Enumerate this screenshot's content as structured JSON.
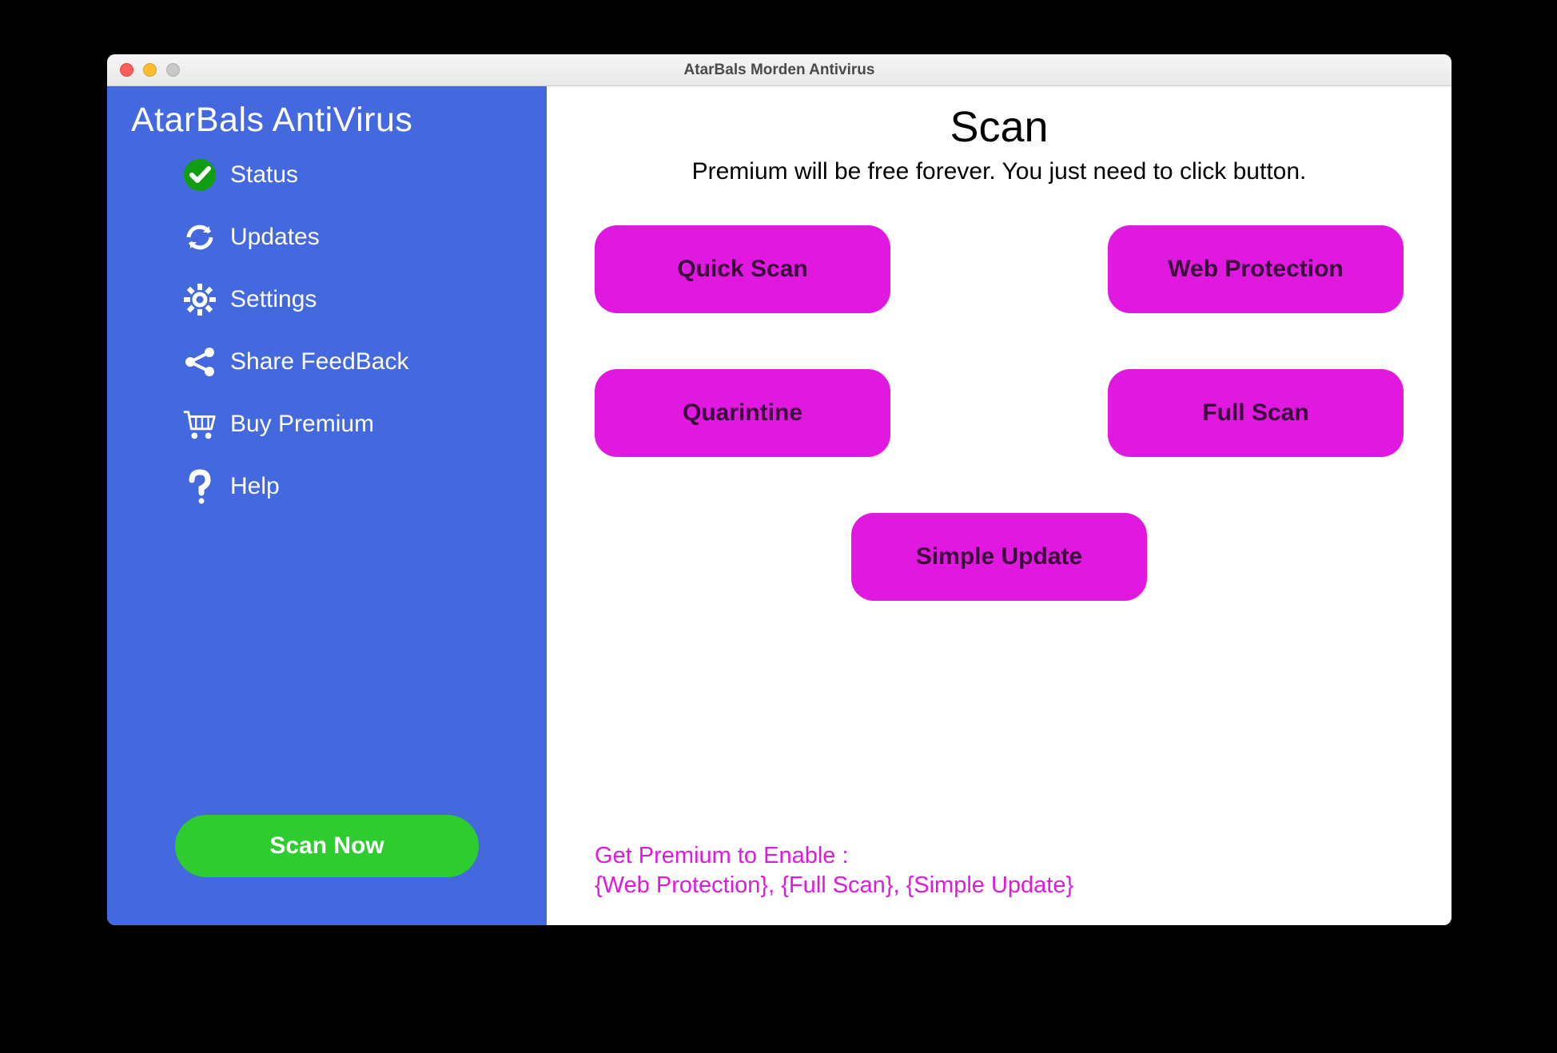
{
  "window": {
    "title": "AtarBals Morden Antivirus"
  },
  "sidebar": {
    "app_title": "AtarBals AntiVirus",
    "items": [
      {
        "label": "Status",
        "icon": "check-circle-icon"
      },
      {
        "label": "Updates",
        "icon": "refresh-icon"
      },
      {
        "label": "Settings",
        "icon": "gear-icon"
      },
      {
        "label": "Share FeedBack",
        "icon": "share-icon"
      },
      {
        "label": "Buy Premium",
        "icon": "cart-icon"
      },
      {
        "label": "Help",
        "icon": "help-icon"
      }
    ],
    "scan_now_label": "Scan Now"
  },
  "main": {
    "title": "Scan",
    "subtitle": "Premium will be free forever. You just need to click button.",
    "buttons": {
      "quick_scan": "Quick Scan",
      "web_protection": "Web Protection",
      "quarantine": "Quarintine",
      "full_scan": "Full Scan",
      "simple_update": "Simple Update"
    },
    "premium_note_line1": "Get Premium to Enable :",
    "premium_note_line2": "{Web Protection}, {Full Scan}, {Simple Update}"
  },
  "colors": {
    "sidebar_bg": "#4468dd",
    "action_btn": "#e018e0",
    "scan_btn": "#2ecc2e"
  }
}
